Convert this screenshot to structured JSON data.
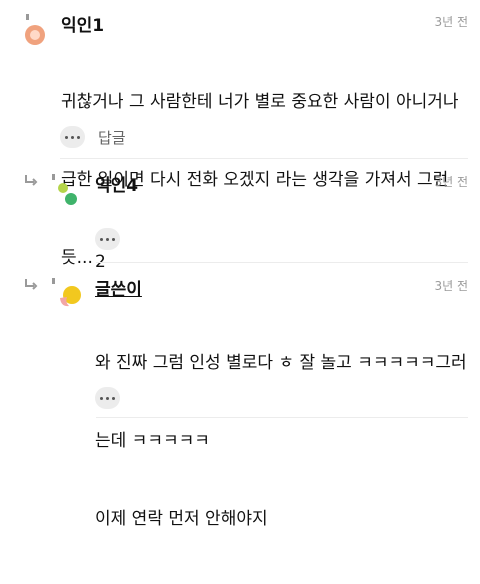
{
  "comments": [
    {
      "author": "익인1",
      "time": "3년 전",
      "lines": [
        "귀찮거나 그 사람한테 너가 별로 중요한 사람이 아니거나",
        "급한 일이면 다시 전화 오겠지 라는 생각을 가져서 그런",
        "듯..."
      ],
      "reply_label": "답글",
      "avatar_color": "#f0a27e"
    },
    {
      "author": "익인4",
      "time": "3년 전",
      "lines": [
        "2"
      ],
      "avatar_color": "#8fc23f"
    },
    {
      "author": "글쓴이",
      "time": "3년 전",
      "lines": [
        "와 진짜 그럼 인성 별로다 ㅎ 잘 놀고 ㅋㅋㅋㅋㅋ그러",
        "는데 ㅋㅋㅋㅋㅋ",
        "이제 연락 먼저 안해야지"
      ],
      "avatar_color": "#f2c81f"
    }
  ]
}
